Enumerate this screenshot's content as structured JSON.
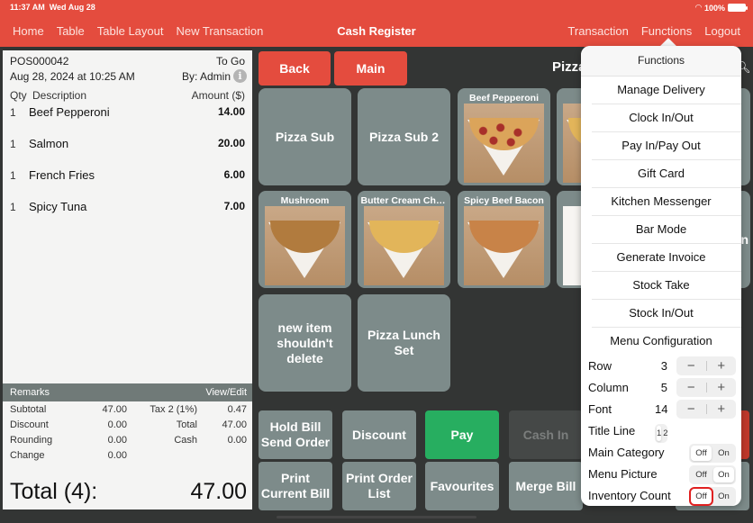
{
  "status_bar": {
    "time": "11:37 AM",
    "date": "Wed Aug 28",
    "battery": "100%"
  },
  "nav": {
    "left": [
      "Home",
      "Table",
      "Table Layout",
      "New Transaction"
    ],
    "title": "Cash Register",
    "right": [
      "Transaction",
      "Functions",
      "Logout"
    ]
  },
  "receipt": {
    "number": "POS000042",
    "order_type": "To Go",
    "datetime": "Aug 28, 2024 at 10:25 AM",
    "by": "By: Admin",
    "headers": {
      "qty": "Qty",
      "description": "Description",
      "amount": "Amount ($)"
    },
    "items": [
      {
        "qty": "1",
        "name": "Beef Pepperoni",
        "amount": "14.00"
      },
      {
        "qty": "1",
        "name": "Salmon",
        "amount": "20.00"
      },
      {
        "qty": "1",
        "name": "French Fries",
        "amount": "6.00"
      },
      {
        "qty": "1",
        "name": "Spicy Tuna",
        "amount": "7.00"
      }
    ],
    "remarks_label": "Remarks",
    "remarks_action": "View/Edit",
    "summary": [
      {
        "k1": "Subtotal",
        "v1": "47.00",
        "k2": "Tax 2 (1%)",
        "v2": "0.47"
      },
      {
        "k1": "Discount",
        "v1": "0.00",
        "k2": "Total",
        "v2": "47.00"
      },
      {
        "k1": "Rounding",
        "v1": "0.00",
        "k2": "Cash",
        "v2": "0.00"
      },
      {
        "k1": "Change",
        "v1": "0.00",
        "k2": "",
        "v2": ""
      }
    ],
    "grand_total_label": "Total (4):",
    "grand_total_value": "47.00"
  },
  "menu": {
    "back_label": "Back",
    "main_label": "Main",
    "category_title": "Pizza",
    "tiles": [
      {
        "label": "Pizza Sub",
        "type": "text"
      },
      {
        "label": "Pizza Sub 2",
        "type": "text"
      },
      {
        "label": "Beef Pepperoni",
        "type": "picture"
      },
      {
        "label": "C",
        "type": "picture"
      },
      {
        "label": "Mushroom",
        "type": "picture"
      },
      {
        "label": "Butter Cream Chick...",
        "type": "picture"
      },
      {
        "label": "Spicy Beef Bacon",
        "type": "picture"
      },
      {
        "label": "P",
        "type": "picture"
      },
      {
        "label": "new item shouldn't delete",
        "type": "text"
      },
      {
        "label": "Pizza Lunch Set",
        "type": "text"
      }
    ],
    "partial_tile_text": "n"
  },
  "actions": [
    {
      "label": "Hold Bill Send Order"
    },
    {
      "label": "Discount"
    },
    {
      "label": "Pay"
    },
    {
      "label": "Cash In"
    },
    {
      "label": "Print Current Bill"
    },
    {
      "label": "Print Order List"
    },
    {
      "label": "Favourites"
    },
    {
      "label": "Merge Bill"
    }
  ],
  "functions_popover": {
    "title": "Functions",
    "items": [
      "Manage Delivery",
      "Clock In/Out",
      "Pay In/Pay Out",
      "Gift Card",
      "Kitchen Messenger",
      "Bar Mode",
      "Generate Invoice",
      "Stock Take",
      "Stock In/Out"
    ],
    "menu_config_label": "Menu Configuration",
    "steppers": [
      {
        "label": "Row",
        "value": "3",
        "minus": "−",
        "plus": "+"
      },
      {
        "label": "Column",
        "value": "5",
        "minus": "−",
        "plus": "+"
      },
      {
        "label": "Font",
        "value": "14",
        "minus": "−",
        "plus": "+"
      }
    ],
    "title_line": {
      "label": "Title Line",
      "options": [
        "1",
        "2"
      ],
      "selected": "1"
    },
    "toggles": [
      {
        "label": "Main Category",
        "off": "Off",
        "on": "On",
        "selected": "Off"
      },
      {
        "label": "Menu Picture",
        "off": "Off",
        "on": "On",
        "selected": "On"
      },
      {
        "label": "Inventory Count",
        "off": "Off",
        "on": "On",
        "selected": "Off",
        "highlighted": true
      }
    ]
  },
  "colors": {
    "brand_red": "#e44c3e",
    "pay_green": "#27ae60",
    "tile_gray": "#7d8b8a",
    "highlight_red": "#e02020"
  }
}
